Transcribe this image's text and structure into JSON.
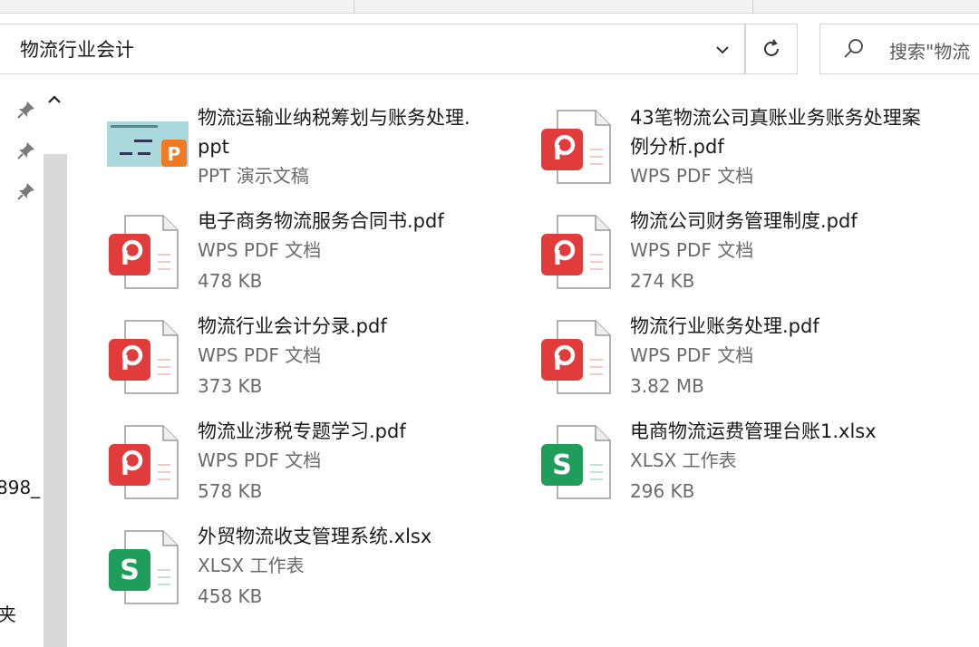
{
  "address": {
    "path": "物流行业会计"
  },
  "search": {
    "placeholder": "搜索\"物流"
  },
  "nav": {
    "partial_1": "898_",
    "partial_2": "夹"
  },
  "files": [
    {
      "name_l1": "物流运输业纳税筹划与账务处理.",
      "name_l2": "ppt",
      "type": "PPT 演示文稿",
      "size": "",
      "icon": "ppt-thumbnail-icon"
    },
    {
      "name_l1": "43笔物流公司真账业务账务处理案",
      "name_l2": "例分析.pdf",
      "type": "WPS PDF 文档",
      "size": "",
      "icon": "wps-pdf-icon"
    },
    {
      "name_l1": "电子商务物流服务合同书.pdf",
      "name_l2": "",
      "type": "WPS PDF 文档",
      "size": "478 KB",
      "icon": "wps-pdf-icon"
    },
    {
      "name_l1": "物流公司财务管理制度.pdf",
      "name_l2": "",
      "type": "WPS PDF 文档",
      "size": "274 KB",
      "icon": "wps-pdf-icon"
    },
    {
      "name_l1": "物流行业会计分录.pdf",
      "name_l2": "",
      "type": "WPS PDF 文档",
      "size": "373 KB",
      "icon": "wps-pdf-icon"
    },
    {
      "name_l1": "物流行业账务处理.pdf",
      "name_l2": "",
      "type": "WPS PDF 文档",
      "size": "3.82 MB",
      "icon": "wps-pdf-icon"
    },
    {
      "name_l1": "物流业涉税专题学习.pdf",
      "name_l2": "",
      "type": "WPS PDF 文档",
      "size": "578 KB",
      "icon": "wps-pdf-icon"
    },
    {
      "name_l1": "电商物流运费管理台账1.xlsx",
      "name_l2": "",
      "type": "XLSX 工作表",
      "size": "296 KB",
      "icon": "xlsx-icon"
    },
    {
      "name_l1": "外贸物流收支管理系统.xlsx",
      "name_l2": "",
      "type": "XLSX 工作表",
      "size": "458 KB",
      "icon": "xlsx-icon"
    }
  ],
  "colors": {
    "pdf_red": "#e23b3b",
    "xlsx_green": "#1e9e5a",
    "ppt_orange": "#f07a21"
  }
}
